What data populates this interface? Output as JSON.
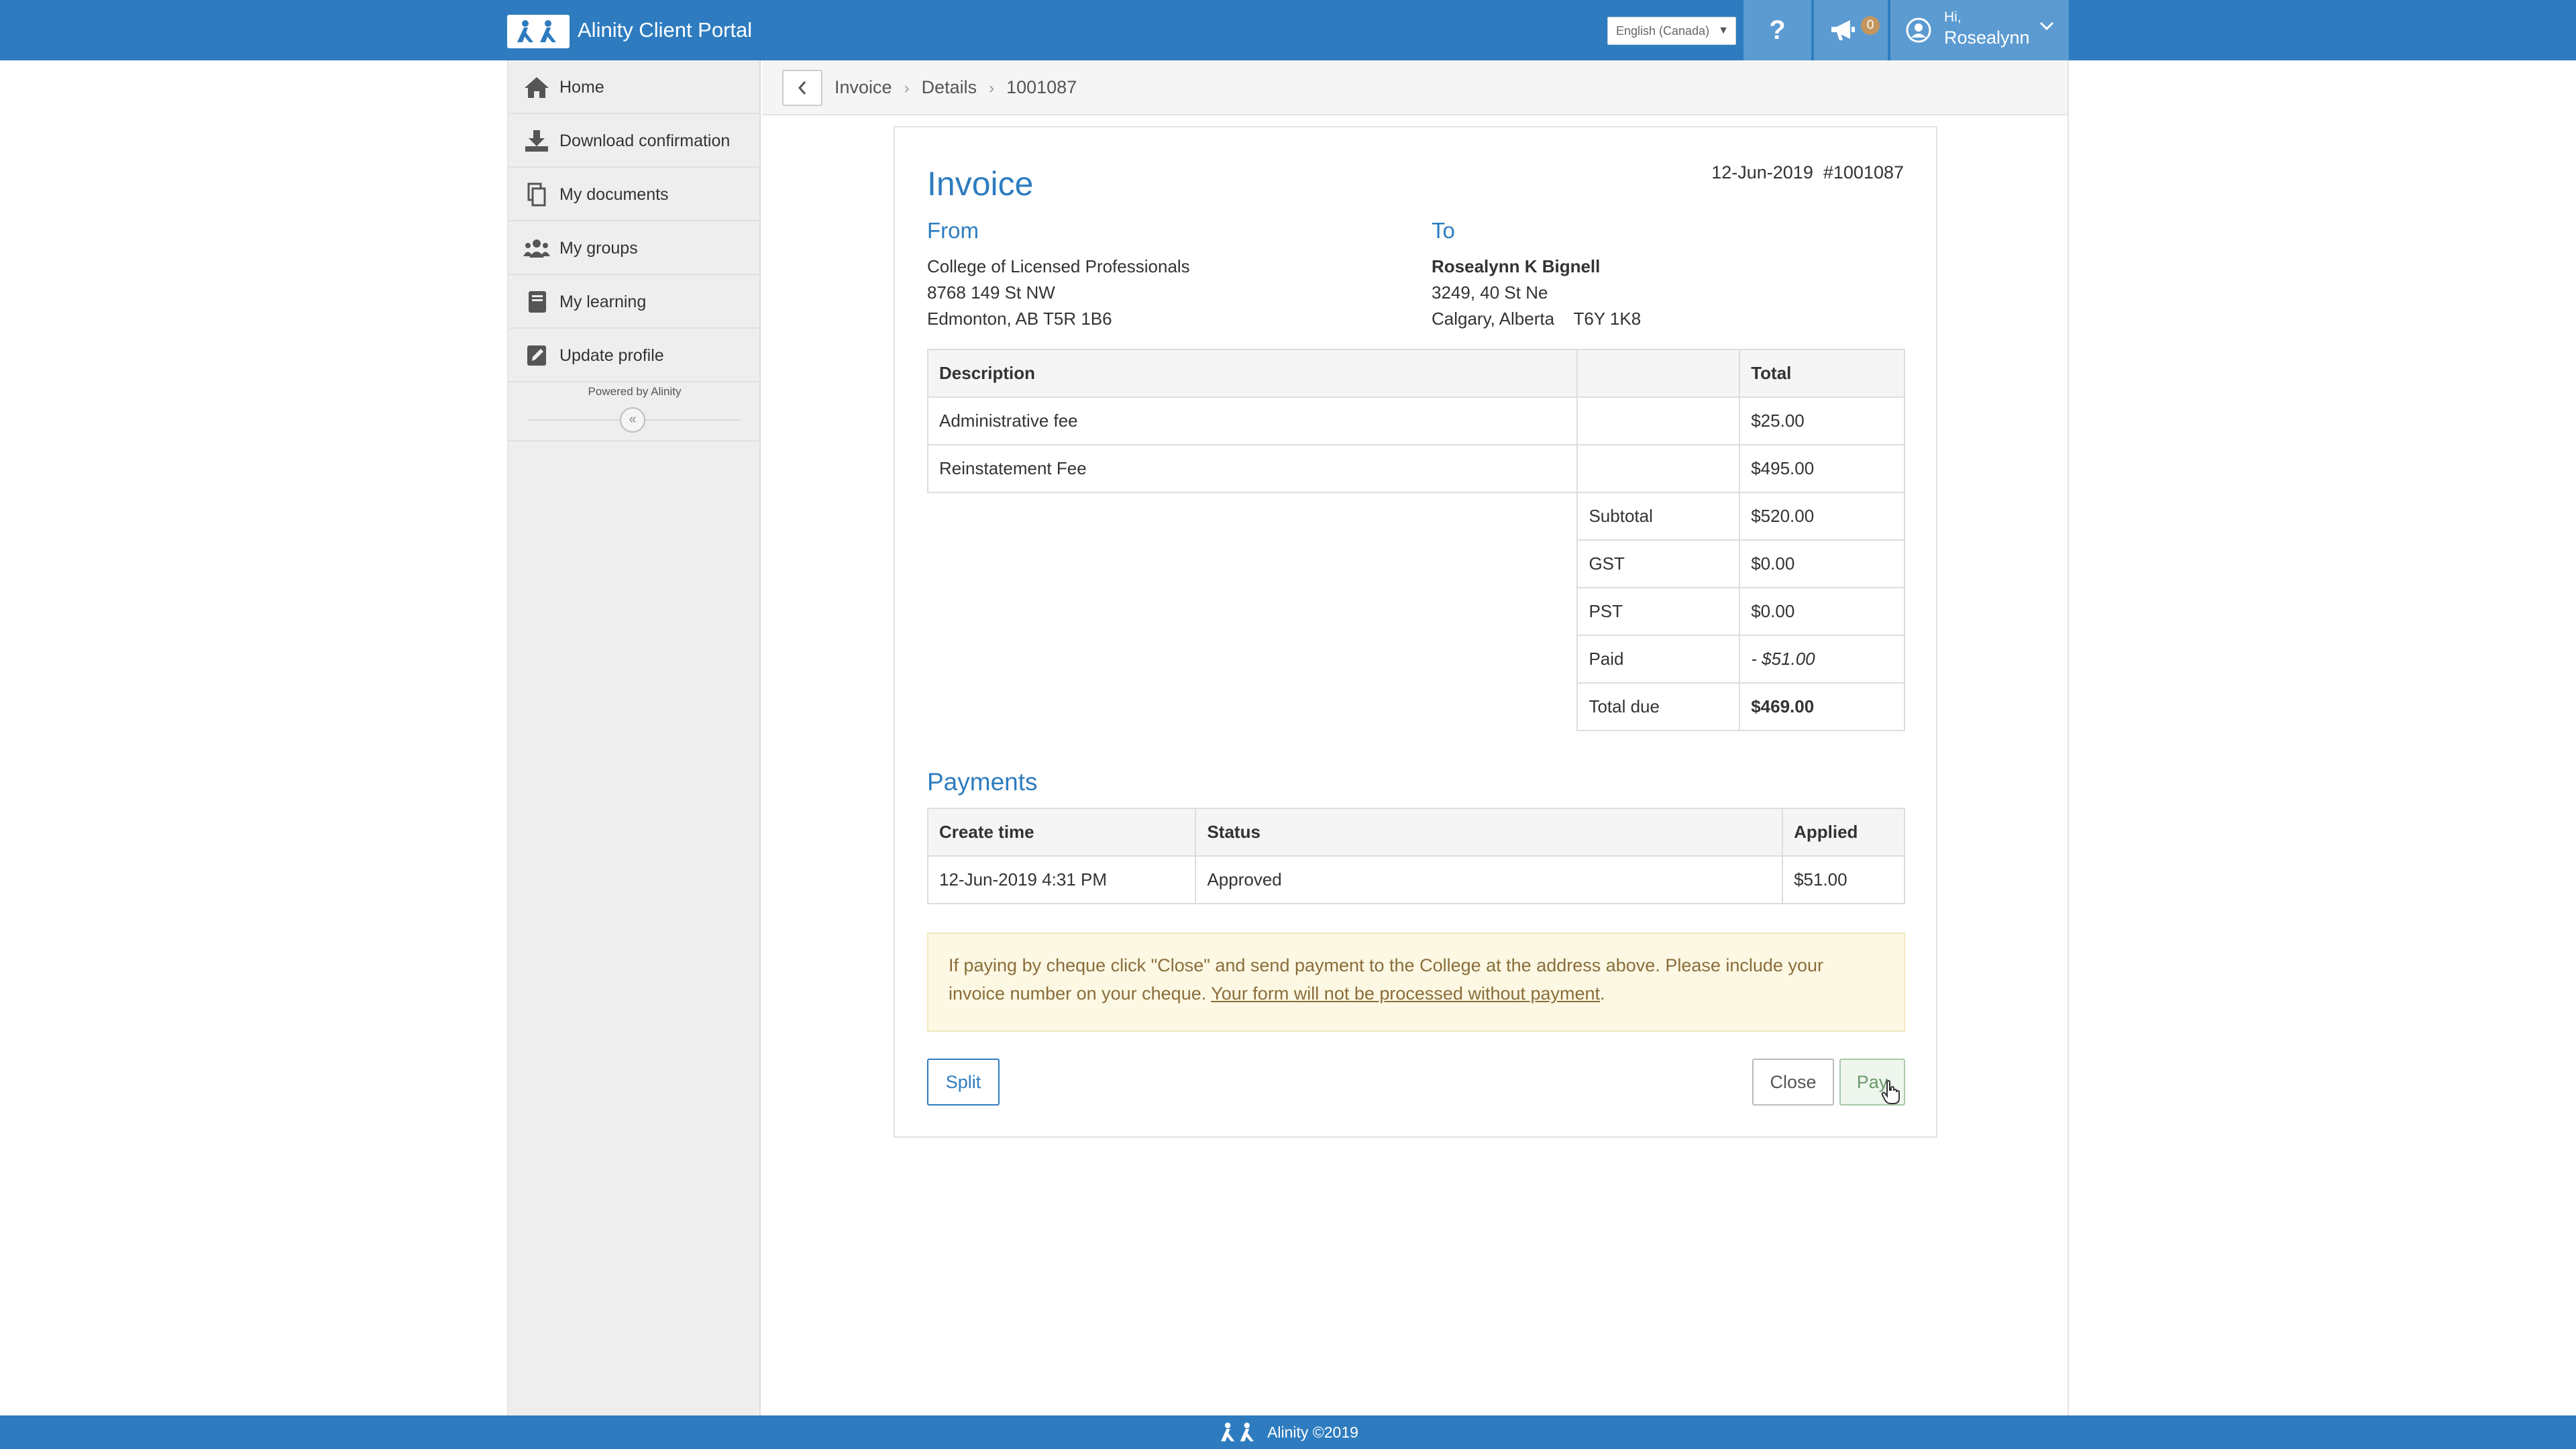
{
  "header": {
    "title": "Alinity Client Portal",
    "language": "English (Canada)",
    "help_label": "?",
    "notifications_count": "0",
    "user_greeting": "Hi,",
    "user_name": "Rosealynn"
  },
  "sidebar": {
    "items": [
      {
        "label": "Home",
        "icon": "home-icon"
      },
      {
        "label": "Download confirmation",
        "icon": "download-icon"
      },
      {
        "label": "My documents",
        "icon": "documents-icon"
      },
      {
        "label": "My groups",
        "icon": "groups-icon"
      },
      {
        "label": "My learning",
        "icon": "book-icon"
      },
      {
        "label": "Update profile",
        "icon": "edit-icon"
      }
    ],
    "powered_by": "Powered by Alinity",
    "collapse_label": "«"
  },
  "breadcrumb": [
    "Invoice",
    "Details",
    "1001087"
  ],
  "invoice": {
    "title": "Invoice",
    "date": "12-Jun-2019",
    "number": "#1001087",
    "from_heading": "From",
    "to_heading": "To",
    "from": [
      "College of Licensed Professionals",
      "8768 149 St NW",
      "Edmonton, AB T5R 1B6"
    ],
    "to": [
      "Rosealynn K Bignell",
      "3249, 40 St Ne",
      "Calgary, Alberta    T6Y 1K8"
    ],
    "columns": {
      "description": "Description",
      "total": "Total"
    },
    "line_items": [
      {
        "description": "Administrative fee",
        "total": "$25.00"
      },
      {
        "description": "Reinstatement Fee",
        "total": "$495.00"
      }
    ],
    "summary": [
      {
        "label": "Subtotal",
        "value": "$520.00"
      },
      {
        "label": "GST",
        "value": "$0.00"
      },
      {
        "label": "PST",
        "value": "$0.00"
      },
      {
        "label": "Paid",
        "value": "- $51.00"
      },
      {
        "label": "Total due",
        "value": "$469.00"
      }
    ]
  },
  "payments": {
    "heading": "Payments",
    "columns": {
      "create_time": "Create time",
      "status": "Status",
      "applied": "Applied"
    },
    "rows": [
      {
        "create_time": "12-Jun-2019 4:31 PM",
        "status": "Approved",
        "applied": "$51.00"
      }
    ]
  },
  "notice": {
    "text": "If paying by cheque click \"Close\" and send payment to the College at the address above. Please include your invoice number on your cheque. ",
    "link": "Your form will not be processed without payment",
    "end": "."
  },
  "buttons": {
    "split": "Split",
    "close": "Close",
    "pay": "Pay"
  },
  "footer": {
    "text": "Alinity ©2019"
  },
  "colors": {
    "primary": "#2e7cbf",
    "notice_bg": "#fcf8e3",
    "notice_text": "#8a6d3b",
    "sidebar_bg": "#eeeeee"
  }
}
